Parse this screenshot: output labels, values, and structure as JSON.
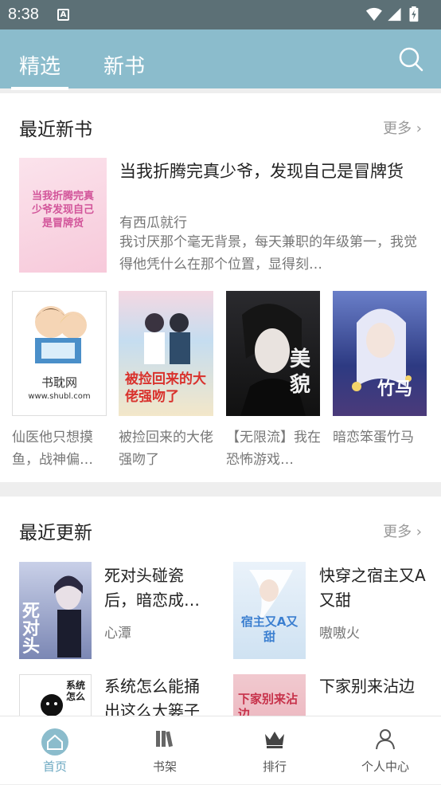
{
  "status": {
    "time": "8:38"
  },
  "tabs": [
    {
      "label": "精选"
    },
    {
      "label": "新书"
    }
  ],
  "recent_new": {
    "title": "最近新书",
    "more": "更多 ›",
    "featured": {
      "title": "当我折腾完真少爷，发现自己是冒牌货",
      "author": "有西瓜就行",
      "desc": "我讨厌那个毫无背景，每天兼职的年级第一，我觉得他凭什么在那个位置，显得刻…",
      "cover_text": "当我折腾完真少爷发现自己是冒牌货"
    },
    "books": [
      {
        "title": "仙医他只想摸鱼，战神偏…",
        "cover_text": "书耽网",
        "cover_sub": "www.shubl.com"
      },
      {
        "title": "被捡回来的大佬强吻了",
        "cover_text": "被捡回来的大佬强吻了"
      },
      {
        "title": "【无限流】我在恐怖游戏…",
        "cover_text": "美貌"
      },
      {
        "title": "暗恋笨蛋竹马",
        "cover_text": "竹马"
      }
    ]
  },
  "recent_update": {
    "title": "最近更新",
    "more": "更多 ›",
    "books": [
      {
        "title": "死对头碰瓷后，暗恋成…",
        "author": "心潭",
        "cover_text": "死对头"
      },
      {
        "title": "快穿之宿主又A又甜",
        "author": "嗷嗷火",
        "cover_text": "宿主又A又甜"
      },
      {
        "title": "系统怎么能捅出这么大篓子",
        "author": "",
        "cover_text": "系统怎么"
      },
      {
        "title": "下家别来沾边",
        "author": "",
        "cover_text": "下家别来沾边"
      }
    ]
  },
  "nav": [
    {
      "label": "首页",
      "icon": "home-icon"
    },
    {
      "label": "书架",
      "icon": "bookshelf-icon"
    },
    {
      "label": "排行",
      "icon": "crown-icon"
    },
    {
      "label": "个人中心",
      "icon": "person-icon"
    }
  ],
  "colors": {
    "accent": "#8bbccc",
    "status_bar": "#5c7076",
    "active_nav": "#6aa7c0"
  }
}
